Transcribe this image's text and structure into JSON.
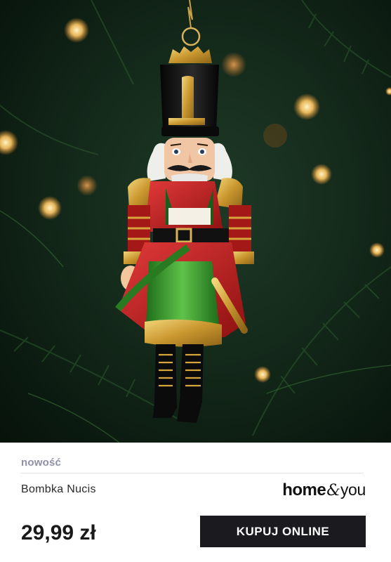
{
  "product": {
    "tag": "nowość",
    "name": "Bombka Nucis",
    "price": "29,99 zł"
  },
  "brand": {
    "home": "home",
    "amp": "&",
    "you": "you"
  },
  "cta": {
    "label": "KUPUJ ONLINE"
  },
  "colors": {
    "button_bg": "#1a1a1f",
    "tag_text": "#8f8fa8",
    "hero_bg": "#142a1b"
  }
}
